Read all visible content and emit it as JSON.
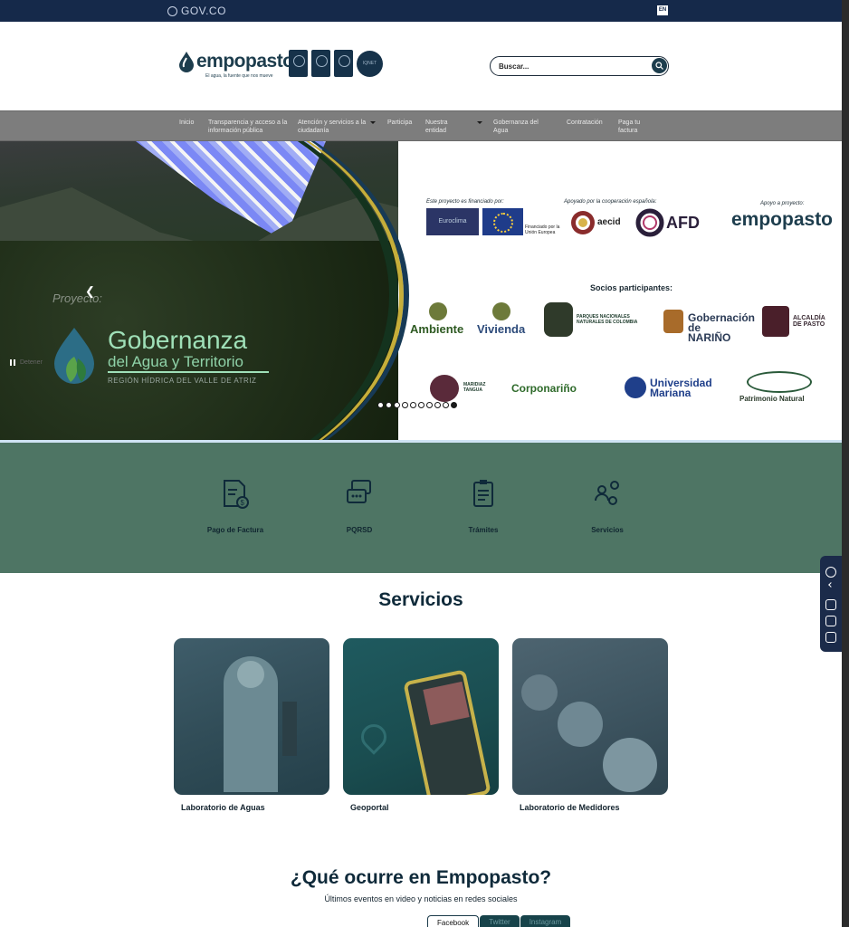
{
  "govbar": {
    "logo_text": "GOV.CO",
    "lang": "EN"
  },
  "header": {
    "logo_text": "empopasto",
    "logo_tagline": "El agua, la fuente que nos mueve",
    "search_placeholder": "Buscar..."
  },
  "nav": {
    "items": [
      {
        "label": "Inicio"
      },
      {
        "label": "Transparencia y acceso a la información pública"
      },
      {
        "label": "Atención y servicios a la ciudadanía"
      },
      {
        "label": "Participa"
      },
      {
        "label": "Nuestra entidad"
      },
      {
        "label": "Gobernanza del Agua"
      },
      {
        "label": "Contratación"
      },
      {
        "label": "Paga tu factura"
      }
    ]
  },
  "hero": {
    "proyecto": "Proyecto:",
    "title": "Gobernanza",
    "subtitle": "del Agua y Territorio",
    "region": "REGIÓN HÍDRICA DEL VALLE DE ATRIZ",
    "pause_label": "Detener",
    "funded_caption": "Este proyecto es financiado por:",
    "executed_caption": "Apoyado por la cooperación española:",
    "support_caption": "Apoyo a proyecto:",
    "euroclima": "Euroclima",
    "eu_label": "Financiado por la Unión Europea",
    "aecid": "aecid",
    "afd": "AFD",
    "emp_logo": "empopasto",
    "socios_title": "Socios participantes:",
    "partners": [
      "Ambiente",
      "Vivienda",
      "PARQUES NACIONALES NATURALES DE COLOMBIA",
      "Gobernación de NARIÑO",
      "ALCALDÍA DE PASTO",
      "MARIDIAZ TANGUA",
      "Corponariño",
      "Universidad Mariana",
      "Patrimonio Natural"
    ],
    "slide_count": 10,
    "active_slide": 9
  },
  "quick": {
    "items": [
      {
        "label": "Pago de Factura",
        "icon": "invoice-payment-icon"
      },
      {
        "label": "PQRSD",
        "icon": "chat-bubbles-icon"
      },
      {
        "label": "Trámites",
        "icon": "clipboard-icon"
      },
      {
        "label": "Servicios",
        "icon": "people-gear-icon"
      }
    ]
  },
  "servicios": {
    "title": "Servicios",
    "cards": [
      {
        "label": "Laboratorio de Aguas"
      },
      {
        "label": "Geoportal"
      },
      {
        "label": "Laboratorio de Medidores"
      }
    ]
  },
  "ocurre": {
    "title": "¿Qué ocurre en Empopasto?",
    "subtitle": "Últimos eventos en video y noticias en redes sociales",
    "tabs": [
      "Facebook",
      "Twitter",
      "Instagram"
    ]
  },
  "colors": {
    "govbar": "#15294a",
    "brand": "#1d3d4d",
    "nav_bg": "#7d7d7d",
    "quick_bg": "#4e7564"
  }
}
